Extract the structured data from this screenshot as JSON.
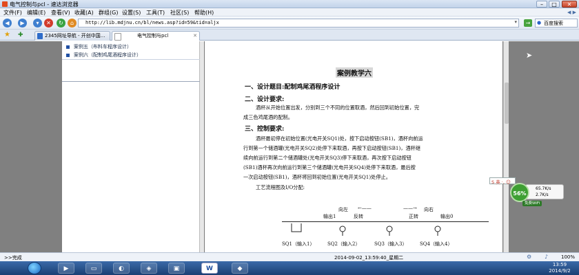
{
  "window": {
    "title": "电气控制与pcl  - 速达浏览器",
    "min": "–",
    "max": "□",
    "close": "✕"
  },
  "menu": [
    "文件(F)",
    "编辑(E)",
    "查看(V)",
    "收藏(A)",
    "群组(G)",
    "设置(S)",
    "工具(T)",
    "社区(S)",
    "帮助(H)"
  ],
  "nav": {
    "address": "http://lib.mdjnu.cn/bl/news.asp?id=59&tid=aljx",
    "search_placeholder": "百度搜索"
  },
  "tabs": [
    {
      "label": "2345网址导航 - 开创中国..."
    },
    {
      "label": "电气控制与pcl"
    }
  ],
  "sidebar": {
    "items": [
      "案例五（布料车程序设计）",
      "案例六（配制鸡尾酒程序设计）"
    ]
  },
  "doc": {
    "title": "案例教学六",
    "h1": "一、设计题目:配制鸡尾酒程序设计",
    "h2": "二、设计要求:",
    "req1": "酒杯从开始位置出发，分别到三个不同的位置取酒，然后回到初始位置，完",
    "req2": "成三色鸡尾酒的配制。",
    "h3": "三、控制要求:",
    "c1": "酒杯最初停在初始位置(光电开关SQ1)处，按下启动按钮(SB1)，酒杯向前运",
    "c2": "行到第一个储酒罐(光电开关SQ2)处停下来取酒，再按下启动按钮(SB1)，酒杯继",
    "c3": "续向前运行到第二个储酒罐处(光电开关SQ3)停下来取酒，再次按下启动按钮",
    "c4": "(SB1)酒杯再次向前运行到第三个储酒罐(光电开关SQ4)处停下来取酒，最后按",
    "c5": "一次启动按钮(SB1)，酒杯将回到初始位置(光电开关SQ1)处停止。",
    "c6": "工艺流程图及I/O分配:"
  },
  "diagram": {
    "left_dir": "向左",
    "left_arrow": "←——",
    "reverse": "反转",
    "output1": "输出1",
    "right_arrow": "——→",
    "right_dir": "向右",
    "forward": "正转",
    "output0": "输出0",
    "sensors": [
      "SQ1（输入1）",
      "SQ2（输入2）",
      "SQ3（输入3）",
      "SQ4（输入4）"
    ]
  },
  "widgets": {
    "ime": "S 英 ·, ☺",
    "net_percent": "56%",
    "net_up": "65.7K/s",
    "net_down": "2.7K/s",
    "wifi": "免费WiFi"
  },
  "status": {
    "left": ">>完成",
    "datetime": "2014-09-02_13:59:40_星期二",
    "zoom": "100%"
  },
  "taskbar": {
    "time": "13:59",
    "date": "2014/9/2",
    "word_icon": "W"
  }
}
